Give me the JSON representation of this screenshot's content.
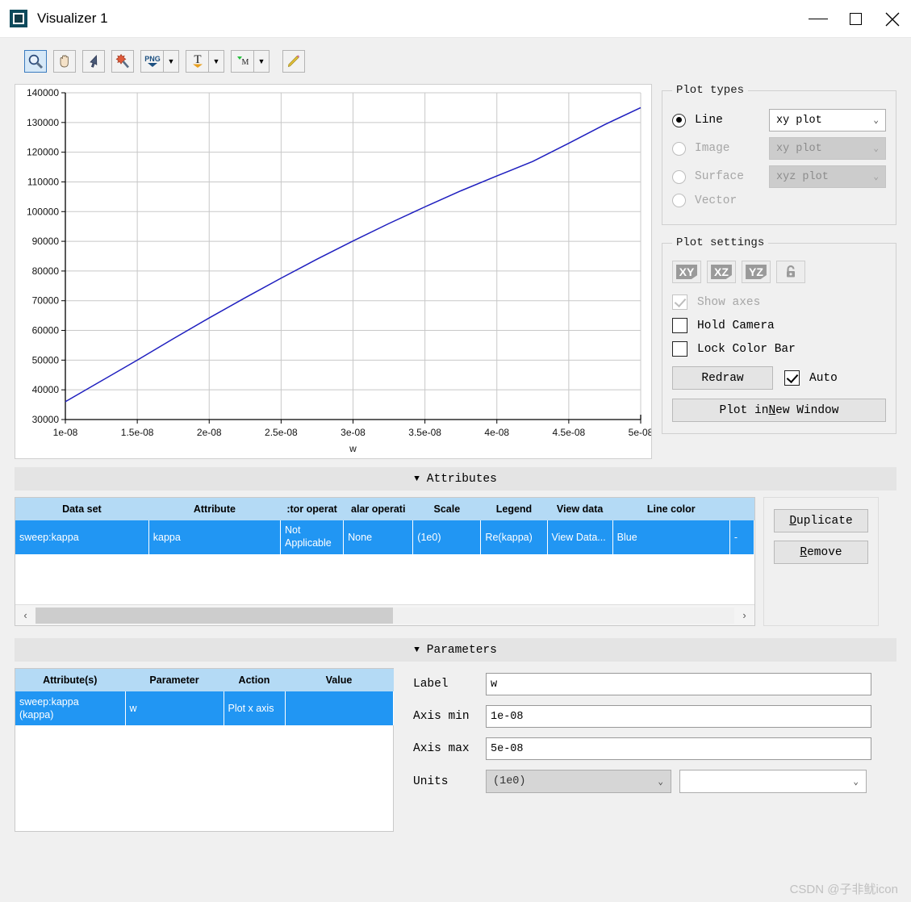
{
  "window": {
    "title": "Visualizer 1",
    "icon": "visualizer-app-icon",
    "minimize": "—",
    "maximize": "□",
    "close": "✕"
  },
  "toolbar": {
    "buttons": [
      {
        "name": "zoom-tool",
        "glyph": "magnifier-icon",
        "selected": true
      },
      {
        "name": "pan-tool",
        "glyph": "hand-icon",
        "selected": false
      },
      {
        "name": "select-tool",
        "glyph": "cursor-arrow-icon",
        "selected": false
      },
      {
        "name": "move-tool",
        "glyph": "move-wand-icon",
        "selected": false
      },
      {
        "name": "export-png",
        "glyph": "png-icon",
        "selected": false,
        "dropdown": true
      },
      {
        "name": "text-tool",
        "glyph": "text-T-icon",
        "selected": false,
        "dropdown": true
      },
      {
        "name": "marker-tool",
        "glyph": "marker-M-icon",
        "selected": false,
        "dropdown": true
      },
      {
        "name": "pencil-tool",
        "glyph": "pencil-icon",
        "selected": false
      }
    ],
    "dropdown_glyph": "▼"
  },
  "chart_data": {
    "type": "line",
    "title": "",
    "xlabel": "w",
    "ylabel": "",
    "xlim": [
      1e-08,
      5e-08
    ],
    "ylim": [
      30000,
      140000
    ],
    "grid": true,
    "legend_position": "none",
    "line_color": "#1f1fbf",
    "xticklabels": [
      "1e-08",
      "1.5e-08",
      "2e-08",
      "2.5e-08",
      "3e-08",
      "3.5e-08",
      "4e-08",
      "4.5e-08",
      "5e-08"
    ],
    "xtickvalues": [
      1e-08,
      1.5e-08,
      2e-08,
      2.5e-08,
      3e-08,
      3.5e-08,
      4e-08,
      4.5e-08,
      5e-08
    ],
    "yticklabels": [
      "30000",
      "40000",
      "50000",
      "60000",
      "70000",
      "80000",
      "90000",
      "100000",
      "110000",
      "120000",
      "130000",
      "140000"
    ],
    "ytickvalues": [
      30000,
      40000,
      50000,
      60000,
      70000,
      80000,
      90000,
      100000,
      110000,
      120000,
      130000,
      140000
    ],
    "series": [
      {
        "name": "Re(kappa)",
        "x": [
          1e-08,
          1.25e-08,
          1.5e-08,
          1.75e-08,
          2e-08,
          2.25e-08,
          2.5e-08,
          2.75e-08,
          3e-08,
          3.25e-08,
          3.5e-08,
          3.75e-08,
          4e-08,
          4.25e-08,
          4.5e-08,
          4.75e-08,
          5e-08
        ],
        "y": [
          36000,
          43000,
          50000,
          57200,
          64200,
          71000,
          77600,
          84000,
          90100,
          96000,
          101600,
          107000,
          112000,
          116900,
          123000,
          129300,
          135000
        ]
      }
    ]
  },
  "plot_types": {
    "legend": "Plot types",
    "options": [
      {
        "label": "Line",
        "selected": true,
        "enabled": true,
        "select_value": "xy plot",
        "select_enabled": true
      },
      {
        "label": "Image",
        "selected": false,
        "enabled": false,
        "select_value": "xy plot",
        "select_enabled": false
      },
      {
        "label": "Surface",
        "selected": false,
        "enabled": false,
        "select_value": "xyz plot",
        "select_enabled": false
      },
      {
        "label": "Vector",
        "selected": false,
        "enabled": false,
        "select_value": null,
        "select_enabled": false
      }
    ],
    "chevron": "⌄"
  },
  "plot_settings": {
    "legend": "Plot settings",
    "view_buttons": [
      {
        "name": "view-xy-button",
        "label": "XY"
      },
      {
        "name": "view-xz-button",
        "label": "XZ"
      },
      {
        "name": "view-yz-button",
        "label": "YZ"
      },
      {
        "name": "lock-view-button",
        "label": "lock-icon"
      }
    ],
    "checkboxes": [
      {
        "label": "Show axes",
        "checked": true,
        "enabled": false
      },
      {
        "label": "Hold Camera",
        "checked": false,
        "enabled": true
      },
      {
        "label": "Lock Color Bar",
        "checked": false,
        "enabled": true
      }
    ],
    "redraw_button": "Redraw",
    "auto_label": "Auto",
    "auto_checked": true,
    "new_window_button_prefix": "Plot in ",
    "new_window_button_accel": "N",
    "new_window_button_suffix": "ew Window"
  },
  "attributes_section": {
    "header": "Attributes",
    "triangle": "▼",
    "columns": [
      "Data set",
      "Attribute",
      ":tor operat",
      "alar operati",
      "Scale",
      "Legend",
      "View data",
      "Line color",
      ""
    ],
    "rows": [
      {
        "data_set": "sweep:kappa",
        "attribute": "kappa",
        "vector_operation": "Not Applicable",
        "scalar_operation": "None",
        "scale": "(1e0)",
        "legend": "Re(kappa)",
        "view_data": "View Data...",
        "line_color": "Blue",
        "extra": "-"
      }
    ],
    "buttons": [
      {
        "name": "duplicate-button",
        "accel": "D",
        "rest": "uplicate"
      },
      {
        "name": "remove-button",
        "accel": "R",
        "rest": "emove"
      }
    ],
    "scroll_left_arrow": "‹",
    "scroll_right_arrow": "›"
  },
  "parameters_section": {
    "header": "Parameters",
    "triangle": "▼",
    "columns": [
      "Attribute(s)",
      "Parameter",
      "Action",
      "Value"
    ],
    "rows": [
      {
        "attributes": "sweep:kappa (kappa)",
        "attributes_line1": "sweep:kappa",
        "attributes_line2": "(kappa)",
        "parameter": "w",
        "action": "Plot x axis",
        "value": ""
      }
    ],
    "form": {
      "label_label": "Label",
      "label_value": "w",
      "axis_min_label": "Axis min",
      "axis_min_value": "1e-08",
      "axis_max_label": "Axis max",
      "axis_max_value": "5e-08",
      "units_label": "Units",
      "units_value": "(1e0)",
      "units2_value": "",
      "chevron": "⌄"
    }
  },
  "watermark": "CSDN @子非鱿icon"
}
